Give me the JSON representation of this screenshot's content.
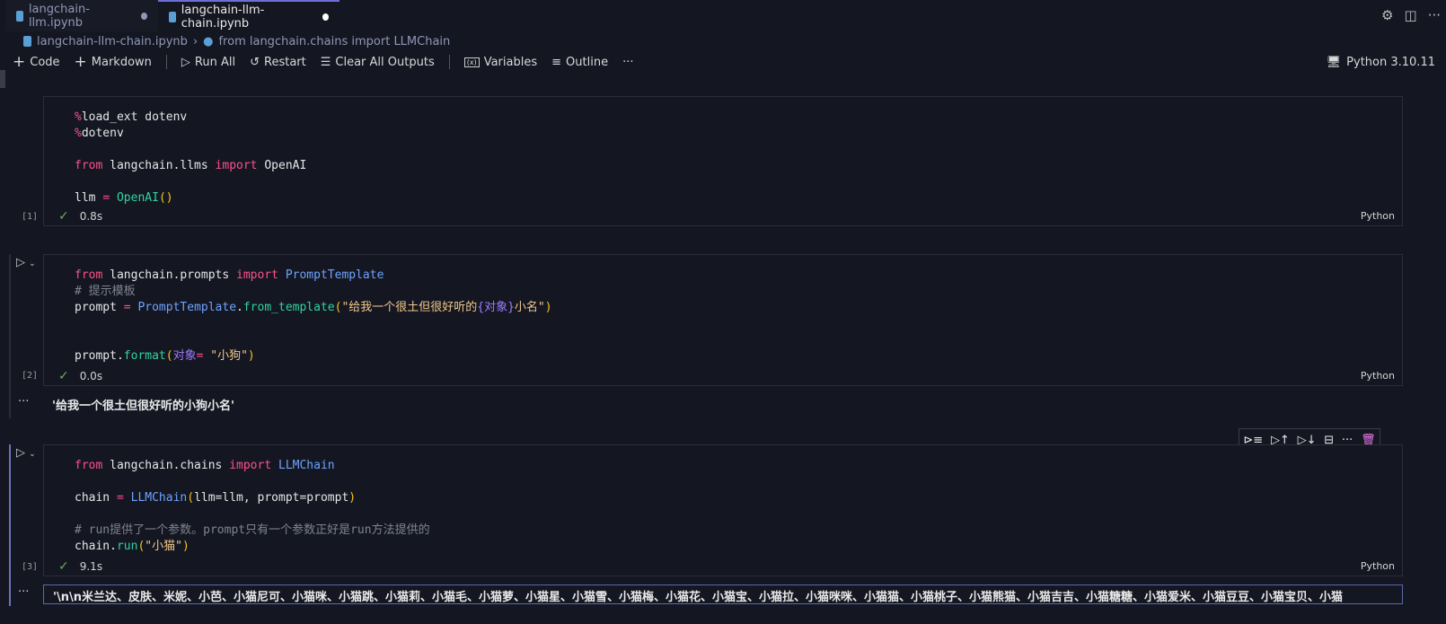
{
  "tabs": [
    {
      "label": "langchain-llm.ipynb",
      "dirty_color": "#8f97b5"
    },
    {
      "label": "langchain-llm-chain.ipynb",
      "dirty_color": "#ffffff"
    }
  ],
  "breadcrumb": {
    "file": "langchain-llm-chain.ipynb",
    "symbol": "from langchain.chains import LLMChain"
  },
  "toolbar": {
    "code": "Code",
    "markdown": "Markdown",
    "run_all": "Run All",
    "restart": "Restart",
    "clear": "Clear All Outputs",
    "variables": "Variables",
    "outline": "Outline",
    "more": "···"
  },
  "kernel": "Python 3.10.11",
  "cells": [
    {
      "count": "[1]",
      "time": "0.8s",
      "lang": "Python",
      "lines": [
        [
          [
            "%",
            "k"
          ],
          [
            "load_ext dotenv",
            ""
          ]
        ],
        [
          [
            "%",
            "k"
          ],
          [
            "dotenv",
            ""
          ]
        ],
        [],
        [
          [
            "from",
            "k"
          ],
          [
            " langchain.llms ",
            ""
          ],
          [
            "import",
            "k"
          ],
          [
            " OpenAI",
            ""
          ]
        ],
        [],
        [
          [
            "llm ",
            ""
          ],
          [
            "=",
            "k"
          ],
          [
            " ",
            ""
          ],
          [
            "OpenAI",
            "f"
          ],
          [
            "()",
            "p"
          ]
        ]
      ]
    },
    {
      "count": "[2]",
      "time": "0.0s",
      "lang": "Python",
      "output": "'给我一个很土但很好听的小狗小名'",
      "lines": [
        [
          [
            "from",
            "k"
          ],
          [
            " langchain.prompts ",
            ""
          ],
          [
            "import",
            "k"
          ],
          [
            " ",
            ""
          ],
          [
            "PromptTemplate",
            "c"
          ]
        ],
        [
          [
            "# 提示模板",
            "cm"
          ]
        ],
        [
          [
            "prompt ",
            ""
          ],
          [
            "=",
            "k"
          ],
          [
            " ",
            ""
          ],
          [
            "PromptTemplate",
            "c"
          ],
          [
            ".",
            ""
          ],
          [
            "from_template",
            "f"
          ],
          [
            "(",
            "p"
          ],
          [
            "\"给我一个很土但很好听的",
            "s"
          ],
          [
            "{对象}",
            "v"
          ],
          [
            "小名\"",
            "s"
          ],
          [
            ")",
            "p"
          ]
        ],
        [],
        [],
        [
          [
            "prompt.",
            ""
          ],
          [
            "format",
            "f"
          ],
          [
            "(",
            "p"
          ],
          [
            "对象",
            "v"
          ],
          [
            "=",
            "k"
          ],
          [
            " ",
            ""
          ],
          [
            "\"小狗\"",
            "s"
          ],
          [
            ")",
            "p"
          ]
        ]
      ]
    },
    {
      "count": "[3]",
      "time": "9.1s",
      "lang": "Python",
      "output": "'\\n\\n米兰达、皮肤、米妮、小芭、小猫尼可、小猫咪、小猫跳、小猫莉、小猫毛、小猫萝、小猫星、小猫雪、小猫梅、小猫花、小猫宝、小猫拉、小猫咪咪、小猫猫、小猫桃子、小猫熊猫、小猫吉吉、小猫糖糖、小猫爱米、小猫豆豆、小猫宝贝、小猫",
      "lines": [
        [
          [
            "from",
            "k"
          ],
          [
            " langchain.chains ",
            ""
          ],
          [
            "import",
            "k"
          ],
          [
            " ",
            ""
          ],
          [
            "LLMChain",
            "c"
          ]
        ],
        [],
        [
          [
            "chain ",
            ""
          ],
          [
            "=",
            "k"
          ],
          [
            " ",
            ""
          ],
          [
            "LLMChain",
            "c"
          ],
          [
            "(",
            "p"
          ],
          [
            "llm=llm, prompt=prompt",
            ""
          ],
          [
            ")",
            "p"
          ]
        ],
        [],
        [
          [
            "# run提供了一个参数。prompt只有一个参数正好是run方法提供的",
            "cm"
          ]
        ],
        [
          [
            "chain.",
            ""
          ],
          [
            "run",
            "f"
          ],
          [
            "(",
            "p"
          ],
          [
            "\"小猫\"",
            "s"
          ],
          [
            ")",
            "p"
          ]
        ]
      ]
    }
  ],
  "colors": {
    "background": "#141722",
    "accent": "#6b6fd6",
    "keyword": "#ff4f8b",
    "class": "#6ea2ff",
    "function": "#2fd3a0",
    "string": "#f2c88a",
    "success": "#6cab5a"
  }
}
